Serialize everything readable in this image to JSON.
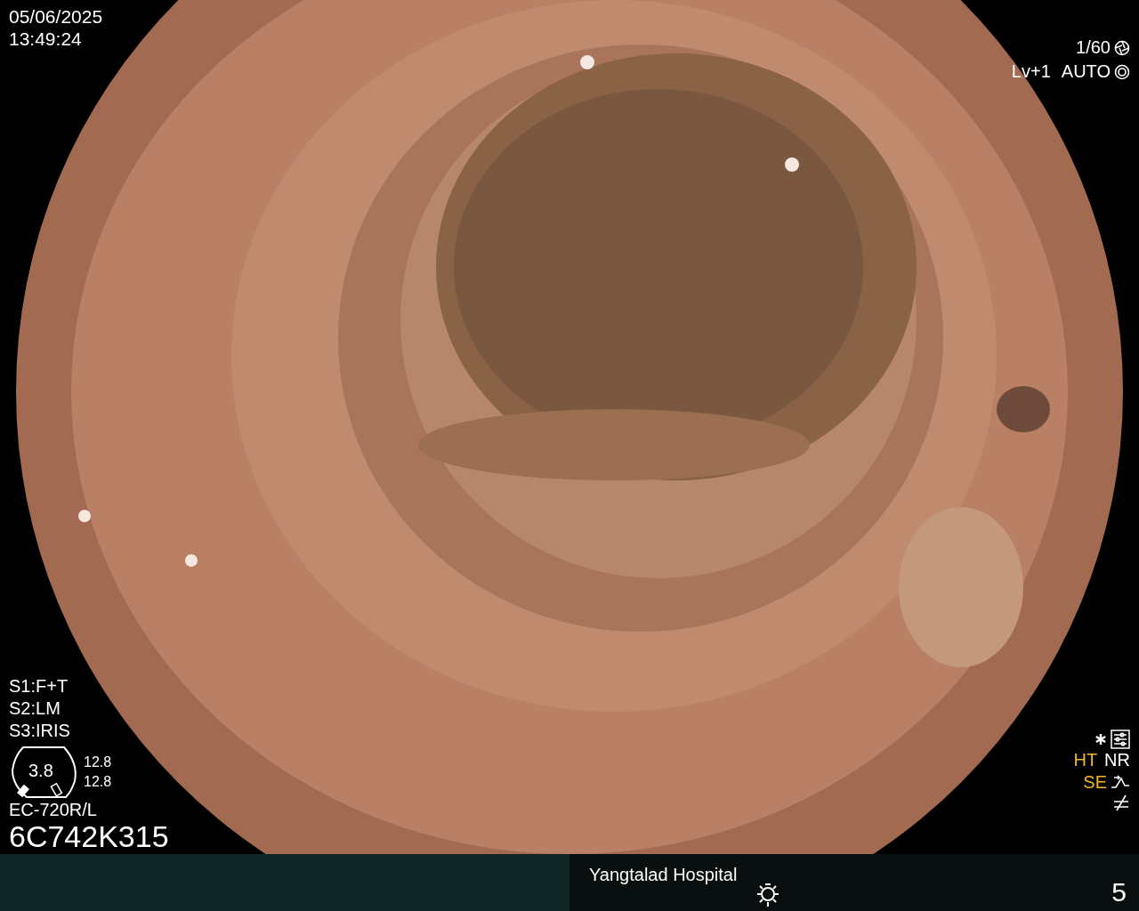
{
  "date": "05/06/2025",
  "time": "13:49:24",
  "exposure": {
    "shutter": "1/60",
    "level": "Lv+1",
    "mode": "AUTO"
  },
  "switches": [
    "S1:F+T",
    "S2:LM",
    "S3:IRIS"
  ],
  "scope": {
    "reading": "3.8",
    "values": [
      "12.8",
      "12.8"
    ],
    "model": "EC-720R/L",
    "serial": "6C742K315"
  },
  "enhancements": [
    {
      "label": "HT",
      "on": true
    },
    {
      "label": "NR",
      "on": false
    },
    {
      "label": "SE",
      "on": true
    }
  ],
  "footer": {
    "hospital": "Yangtalad Hospital",
    "page": "5"
  }
}
